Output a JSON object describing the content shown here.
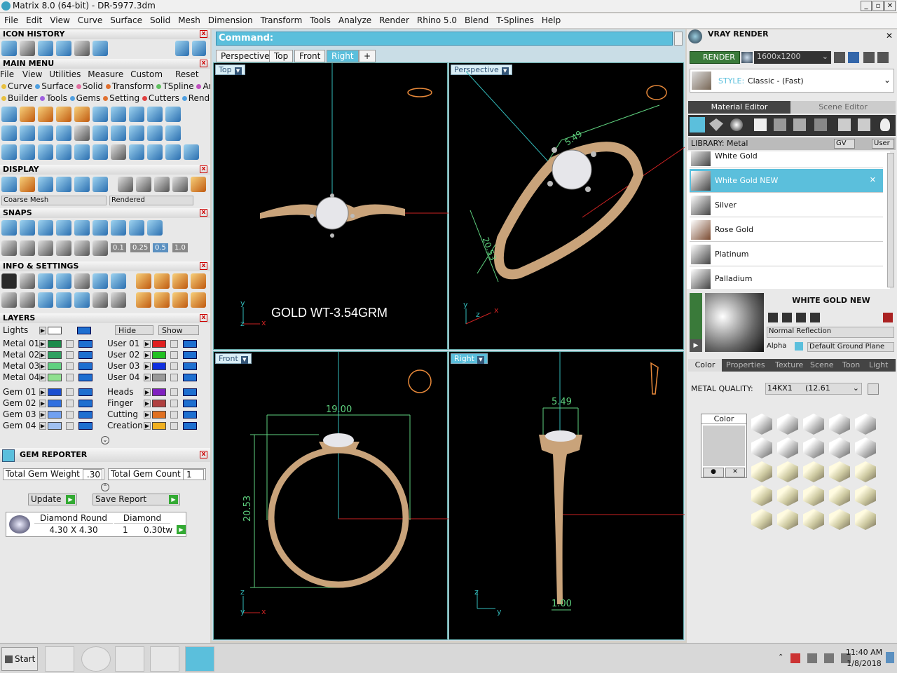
{
  "window": {
    "title": "Matrix 8.0 (64-bit) - DR-5977.3dm"
  },
  "menu": [
    "File",
    "Edit",
    "View",
    "Curve",
    "Surface",
    "Solid",
    "Mesh",
    "Dimension",
    "Transform",
    "Tools",
    "Analyze",
    "Render",
    "Rhino 5.0",
    "Blend",
    "T-Splines",
    "Help"
  ],
  "left": {
    "icon_history": "ICON HISTORY",
    "main_menu": "MAIN MENU",
    "main_menu_items": [
      "File",
      "View",
      "Utilities",
      "Measure",
      "Custom"
    ],
    "reset": "Reset",
    "categories_row1": [
      "Curve",
      "Surface",
      "Solid",
      "Transform",
      "TSpline",
      "Art"
    ],
    "categories_row2": [
      "Builder",
      "Tools",
      "Gems",
      "Setting",
      "Cutters",
      "Render"
    ],
    "display": "DISPLAY",
    "mesh_select": "Coarse Mesh",
    "render_select": "Rendered",
    "snaps": "SNAPS",
    "snap_values": [
      "0.1",
      "0.25",
      "0.5",
      "1.0"
    ],
    "info": "INFO & SETTINGS",
    "layers": "LAYERS",
    "lights": "Lights",
    "hide": "Hide",
    "show": "Show",
    "layers_left": [
      "Metal 01",
      "Metal 02",
      "Metal 03",
      "Metal 04",
      "Gem 01",
      "Gem 02",
      "Gem 03",
      "Gem 04"
    ],
    "layers_right": [
      "User 01",
      "User 02",
      "User 03",
      "User 04",
      "Heads",
      "Finger",
      "Cutting",
      "Creation"
    ],
    "gem_reporter": "GEM REPORTER",
    "total_gem_weight_label": "Total Gem Weight",
    "total_gem_weight": ".30",
    "total_gem_count_label": "Total Gem Count",
    "total_gem_count": "1",
    "update": "Update",
    "save_report": "Save Report",
    "gem_name": "Diamond Round",
    "gem_type": "Diamond",
    "gem_size": "4.30 X 4.30",
    "gem_qty": "1",
    "gem_weight": "0.30tw"
  },
  "center": {
    "command": "Command:",
    "tabs": [
      "Perspective",
      "Top",
      "Front",
      "Right"
    ],
    "add_tab": "+",
    "viewports": {
      "top": "Top",
      "perspective": "Perspective",
      "front": "Front",
      "right": "Right"
    },
    "gold_weight": "GOLD WT-3.54GRM",
    "dims": {
      "width": "19.00",
      "height": "20.53",
      "side_width": "5.49",
      "shank": "1.00",
      "persp1": "20.53",
      "persp2": "5.49"
    },
    "axes": {
      "x": "x",
      "y": "y",
      "z": "z"
    }
  },
  "right": {
    "title": "VRAY RENDER",
    "render": "RENDER",
    "resolution": "1600x1200",
    "style_label": "STYLE:",
    "style_value": "Classic - (Fast)",
    "tabs": [
      "Material Editor",
      "Scene Editor"
    ],
    "library": "LIBRARY: Metal",
    "gv": "GV",
    "user": "User",
    "materials": [
      "White Gold",
      "White Gold NEW",
      "Silver",
      "Rose Gold",
      "Platinum",
      "Palladium"
    ],
    "selected_material": "WHITE GOLD NEW",
    "reflection": "Normal Reflection",
    "alpha": "Alpha",
    "ground": "Default Ground Plane",
    "sub_tabs": [
      "Color",
      "Properties",
      "Texture",
      "Scene",
      "Toon",
      "Light"
    ],
    "metal_quality_label": "METAL QUALITY:",
    "metal_quality": "14KX1",
    "metal_quality_value": "(12.61",
    "color_label": "Color"
  },
  "taskbar": {
    "start": "Start",
    "time": "11:40 AM",
    "date": "1/8/2018"
  }
}
